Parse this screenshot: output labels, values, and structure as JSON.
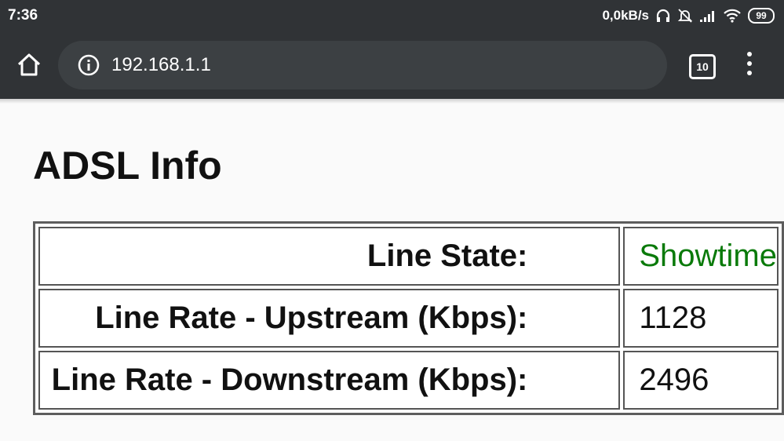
{
  "status_bar": {
    "time": "7:36",
    "net_speed": "0,0kB/s",
    "battery": "99",
    "icons": [
      "headphones-icon",
      "bell-muted-icon",
      "signal-icon",
      "wifi-icon",
      "battery-icon"
    ]
  },
  "browser": {
    "url": "192.168.1.1",
    "tab_count": "10"
  },
  "page": {
    "title": "ADSL Info",
    "rows": [
      {
        "label": "Line State:",
        "value": "Showtime",
        "value_color": "#0a7a0a"
      },
      {
        "label": "Line Rate - Upstream (Kbps):",
        "value": "1128"
      },
      {
        "label": "Line Rate - Downstream (Kbps):",
        "value": "2496"
      }
    ]
  }
}
